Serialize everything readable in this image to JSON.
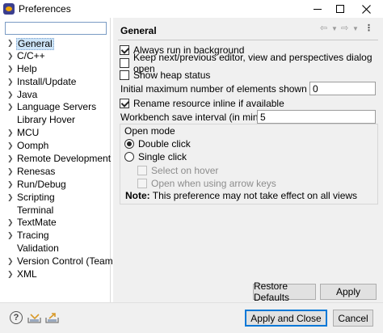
{
  "window": {
    "title": "Preferences"
  },
  "filter": {
    "value": ""
  },
  "tree": [
    {
      "label": "General",
      "expandable": true,
      "selected": true
    },
    {
      "label": "C/C++",
      "expandable": true
    },
    {
      "label": "Help",
      "expandable": true
    },
    {
      "label": "Install/Update",
      "expandable": true
    },
    {
      "label": "Java",
      "expandable": true
    },
    {
      "label": "Language Servers",
      "expandable": true
    },
    {
      "label": "Library Hover",
      "expandable": false
    },
    {
      "label": "MCU",
      "expandable": true
    },
    {
      "label": "Oomph",
      "expandable": true
    },
    {
      "label": "Remote Development",
      "expandable": true
    },
    {
      "label": "Renesas",
      "expandable": true
    },
    {
      "label": "Run/Debug",
      "expandable": true
    },
    {
      "label": "Scripting",
      "expandable": true
    },
    {
      "label": "Terminal",
      "expandable": false
    },
    {
      "label": "TextMate",
      "expandable": true
    },
    {
      "label": "Tracing",
      "expandable": true
    },
    {
      "label": "Validation",
      "expandable": false
    },
    {
      "label": "Version Control (Team)",
      "expandable": true
    },
    {
      "label": "XML",
      "expandable": true
    }
  ],
  "page": {
    "title": "General",
    "options": {
      "always_run_background": {
        "label": "Always run in background",
        "checked": true
      },
      "keep_next_previous": {
        "label": "Keep next/previous editor, view and perspectives dialog open",
        "checked": false
      },
      "show_heap_status": {
        "label": "Show heap status",
        "checked": false
      },
      "rename_inline": {
        "label": "Rename resource inline if available",
        "checked": true
      }
    },
    "max_elements": {
      "label": "Initial maximum number of elements shown in views:",
      "value": "0"
    },
    "save_interval": {
      "label": "Workbench save interval (in minutes):",
      "value": "5"
    },
    "open_mode": {
      "label": "Open mode",
      "double_click": "Double click",
      "single_click": "Single click",
      "selected": "double_click",
      "select_on_hover": "Select on hover",
      "open_arrow_keys": "Open when using arrow keys"
    },
    "note": {
      "prefix": "Note:",
      "text": "This preference may not take effect on all views"
    },
    "restore_defaults": "Restore Defaults",
    "apply": "Apply"
  },
  "footer": {
    "apply_close": "Apply and Close",
    "cancel": "Cancel"
  },
  "icons": {
    "help": "?"
  }
}
